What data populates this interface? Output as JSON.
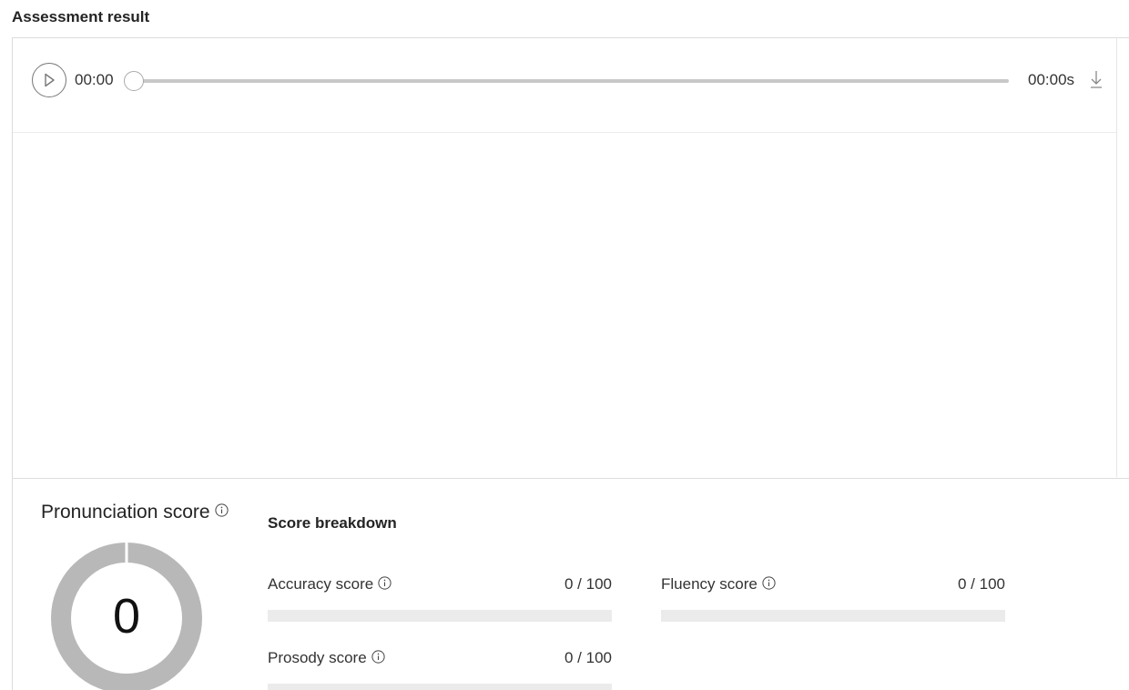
{
  "header": {
    "title": "Assessment result"
  },
  "player": {
    "current_time": "00:00",
    "total_time": "00:00s",
    "progress": 0
  },
  "pronunciation": {
    "title": "Pronunciation score",
    "value": "0",
    "score": 0,
    "max": 100,
    "ring_color": "#b8b8b8"
  },
  "breakdown": {
    "title": "Score breakdown",
    "metrics": [
      {
        "label": "Accuracy score",
        "value": "0 / 100",
        "score": 0
      },
      {
        "label": "Fluency score",
        "value": "0 / 100",
        "score": 0
      },
      {
        "label": "Prosody score",
        "value": "0 / 100",
        "score": 0
      }
    ]
  },
  "icons": {
    "play": "play-icon",
    "download": "download-icon",
    "info": "info-icon"
  }
}
